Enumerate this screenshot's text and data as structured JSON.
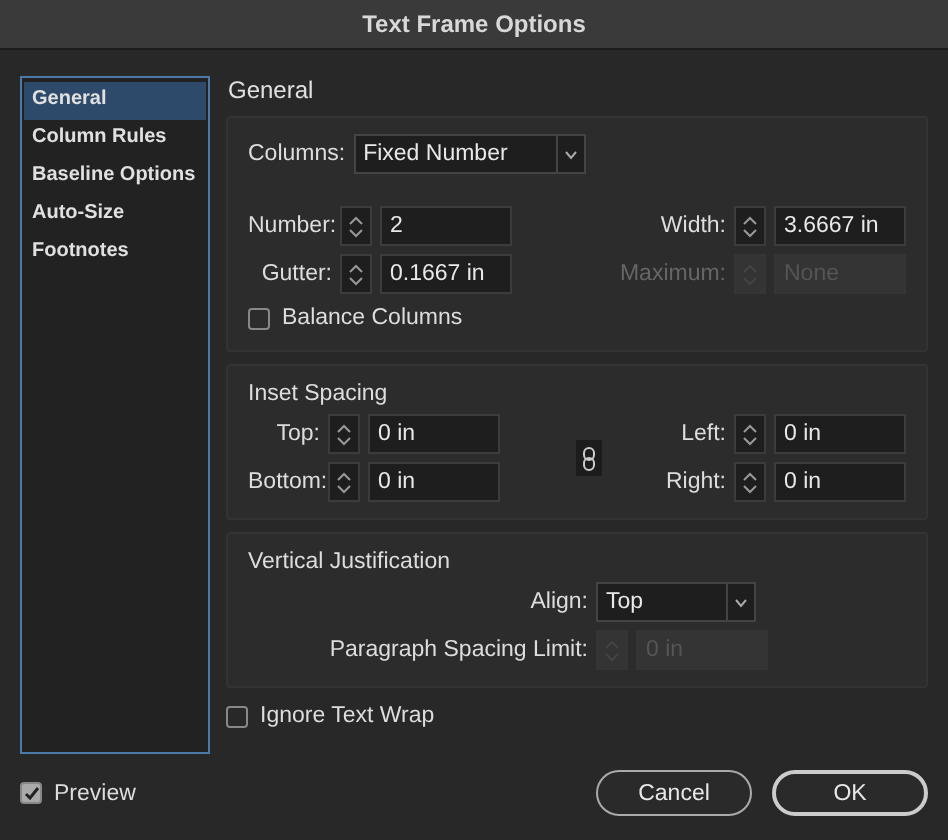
{
  "window": {
    "title": "Text Frame Options"
  },
  "sidebar": {
    "items": [
      {
        "label": "General",
        "selected": true
      },
      {
        "label": "Column Rules",
        "selected": false
      },
      {
        "label": "Baseline Options",
        "selected": false
      },
      {
        "label": "Auto-Size",
        "selected": false
      },
      {
        "label": "Footnotes",
        "selected": false
      }
    ]
  },
  "heading": "General",
  "columns": {
    "label": "Columns:",
    "value": "Fixed Number",
    "fields": [
      {
        "label": "Number:",
        "value": "2",
        "disabled": false
      },
      {
        "label": "Width:",
        "value": "3.6667 in",
        "disabled": false
      },
      {
        "label": "Gutter:",
        "value": "0.1667 in",
        "disabled": false
      },
      {
        "label": "Maximum:",
        "value": "None",
        "disabled": true
      }
    ],
    "balance": {
      "label": "Balance Columns",
      "checked": false
    }
  },
  "inset": {
    "title": "Inset Spacing",
    "fields": [
      {
        "label": "Top:",
        "value": "0 in",
        "disabled": false
      },
      {
        "label": "Left:",
        "value": "0 in",
        "disabled": false
      },
      {
        "label": "Bottom:",
        "value": "0 in",
        "disabled": false
      },
      {
        "label": "Right:",
        "value": "0 in",
        "disabled": false
      }
    ]
  },
  "vertical": {
    "title": "Vertical Justification",
    "align": {
      "label": "Align:",
      "value": "Top"
    },
    "spacing": {
      "label": "Paragraph Spacing Limit:",
      "value": "0 in",
      "disabled": true
    }
  },
  "ignore_wrap": {
    "label": "Ignore Text Wrap",
    "checked": false
  },
  "preview": {
    "label": "Preview",
    "checked": true
  },
  "buttons": [
    {
      "label": "Cancel",
      "kind": "default"
    },
    {
      "label": "OK",
      "kind": "primary"
    }
  ]
}
